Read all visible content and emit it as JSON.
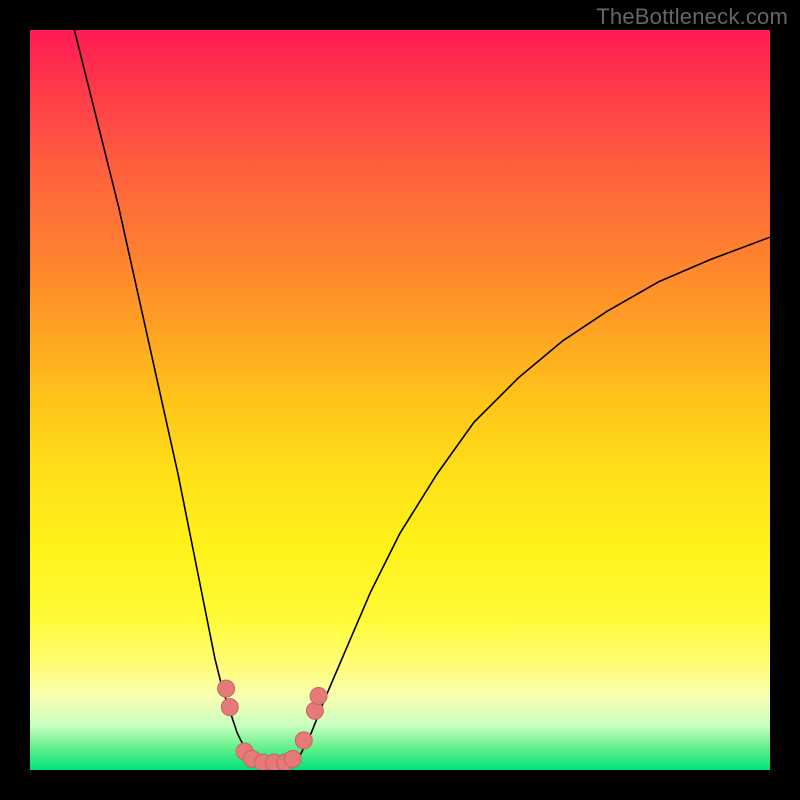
{
  "watermark": "TheBottleneck.com",
  "colors": {
    "background_frame": "#000000",
    "curve_stroke": "#000000",
    "marker_fill": "#e67a78",
    "marker_stroke": "#cc6260",
    "gradient_top": "#ff1a55",
    "gradient_bottom": "#00e27a"
  },
  "chart_data": {
    "type": "line",
    "title": "",
    "xlabel": "",
    "ylabel": "",
    "xlim": [
      0,
      100
    ],
    "ylim": [
      0,
      100
    ],
    "note": "No axes or tick labels visible; values are estimated from pixel positions on a 0–100 scale. y=0 at bottom (green), y=100 at top (red).",
    "series": [
      {
        "name": "left-branch",
        "x": [
          6,
          8,
          10,
          12,
          14,
          16,
          18,
          20,
          22,
          24,
          25,
          26,
          27,
          28,
          29,
          30
        ],
        "y": [
          100,
          92,
          84,
          76,
          67,
          58,
          49,
          40,
          30,
          20,
          15,
          11,
          8,
          5,
          3,
          1
        ]
      },
      {
        "name": "right-branch",
        "x": [
          36,
          38,
          40,
          43,
          46,
          50,
          55,
          60,
          66,
          72,
          78,
          85,
          92,
          100
        ],
        "y": [
          1,
          5,
          10,
          17,
          24,
          32,
          40,
          47,
          53,
          58,
          62,
          66,
          69,
          72
        ]
      },
      {
        "name": "valley-floor",
        "x": [
          30,
          31,
          32,
          33,
          34,
          35,
          36
        ],
        "y": [
          1,
          0.5,
          0.3,
          0.3,
          0.3,
          0.5,
          1
        ]
      }
    ],
    "markers": {
      "name": "highlight-dots",
      "points": [
        {
          "x": 26.5,
          "y": 11
        },
        {
          "x": 27,
          "y": 8.5
        },
        {
          "x": 29,
          "y": 2.5
        },
        {
          "x": 30,
          "y": 1.5
        },
        {
          "x": 31.5,
          "y": 1
        },
        {
          "x": 33,
          "y": 1
        },
        {
          "x": 34.5,
          "y": 1
        },
        {
          "x": 35.5,
          "y": 1.5
        },
        {
          "x": 37,
          "y": 4
        },
        {
          "x": 38.5,
          "y": 8
        },
        {
          "x": 39,
          "y": 10
        }
      ]
    }
  }
}
